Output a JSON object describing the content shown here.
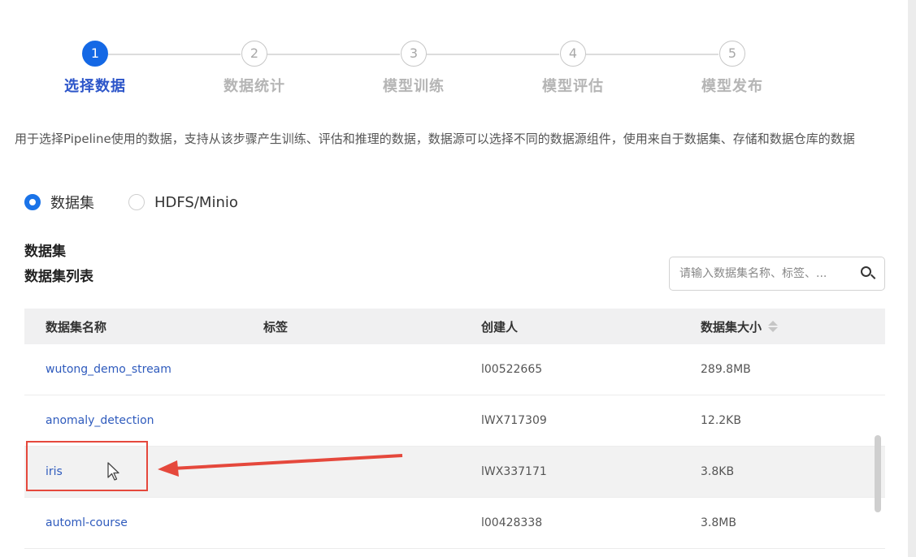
{
  "steps": [
    {
      "number": "1",
      "label": "选择数据",
      "active": true
    },
    {
      "number": "2",
      "label": "数据统计",
      "active": false
    },
    {
      "number": "3",
      "label": "模型训练",
      "active": false
    },
    {
      "number": "4",
      "label": "模型评估",
      "active": false
    },
    {
      "number": "5",
      "label": "模型发布",
      "active": false
    }
  ],
  "description": "用于选择Pipeline使用的数据，支持从该步骤产生训练、评估和推理的数据，数据源可以选择不同的数据源组件，使用来自于数据集、存储和数据仓库的数据",
  "source_options": [
    {
      "label": "数据集",
      "checked": true
    },
    {
      "label": "HDFS/Minio",
      "checked": false
    }
  ],
  "section_title": "数据集",
  "list_title": "数据集列表",
  "search": {
    "placeholder": "请输入数据集名称、标签、..."
  },
  "table": {
    "columns": [
      "数据集名称",
      "标签",
      "创建人",
      "数据集大小"
    ],
    "rows": [
      {
        "name": "wutong_demo_stream",
        "tag": "",
        "creator": "l00522665",
        "size": "289.8MB"
      },
      {
        "name": "anomaly_detection",
        "tag": "",
        "creator": "lWX717309",
        "size": "12.2KB"
      },
      {
        "name": "iris",
        "tag": "",
        "creator": "lWX337171",
        "size": "3.8KB"
      },
      {
        "name": "automl-course",
        "tag": "",
        "creator": "l00428338",
        "size": "3.8MB"
      }
    ]
  },
  "colors": {
    "accent": "#1468e5",
    "link": "#2f5bbd",
    "annotation": "#e5483c"
  }
}
